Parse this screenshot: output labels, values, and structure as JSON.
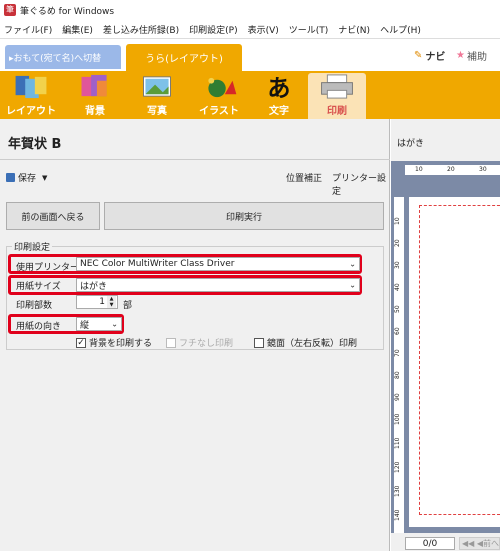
{
  "window": {
    "title": "筆ぐるめ for Windows"
  },
  "menu": [
    "ファイル(F)",
    "編集(E)",
    "差し込み住所録(B)",
    "印刷設定(P)",
    "表示(V)",
    "ツール(T)",
    "ナビ(N)",
    "ヘルプ(H)"
  ],
  "tabs": {
    "front": "▸おもて(宛て名)へ切替",
    "back": "うら(レイアウト)"
  },
  "navi_label": "ナビ",
  "hojo_label": "補助",
  "ribbon": [
    "レイアウト",
    "背景",
    "写真",
    "イラスト",
    "文字",
    "印刷"
  ],
  "doc_title": "年賀状 B",
  "toolbar": {
    "save": "保存",
    "position_adjust": "位置補正",
    "printer_settings": "プリンター設定"
  },
  "buttons": {
    "back": "前の画面へ戻る",
    "print": "印刷実行"
  },
  "print_settings": {
    "group_label": "印刷設定",
    "printer_label": "使用プリンター",
    "printer_value": "NEC Color MultiWriter Class Driver",
    "paper_size_label": "用紙サイズ",
    "paper_size_value": "はがき",
    "copies_label": "印刷部数",
    "copies_value": "1",
    "copies_unit": "部",
    "orientation_label": "用紙の向き",
    "orientation_value": "縦",
    "print_background": "背景を印刷する",
    "borderless": "フチなし印刷",
    "mirror": "鏡面（左右反転）印刷"
  },
  "preview": {
    "title": "はがき",
    "ruler_h": [
      "10",
      "20",
      "30"
    ],
    "ruler_v": [
      "10",
      "20",
      "30",
      "40",
      "50",
      "60",
      "70",
      "80",
      "90",
      "100",
      "110",
      "120",
      "130",
      "140"
    ],
    "page_indicator": "0/0",
    "prev_label": "前へ"
  },
  "colors": {
    "ribbon": "#f0a800",
    "highlight": "#e0001b",
    "active_tab": "#fbe3b6"
  }
}
